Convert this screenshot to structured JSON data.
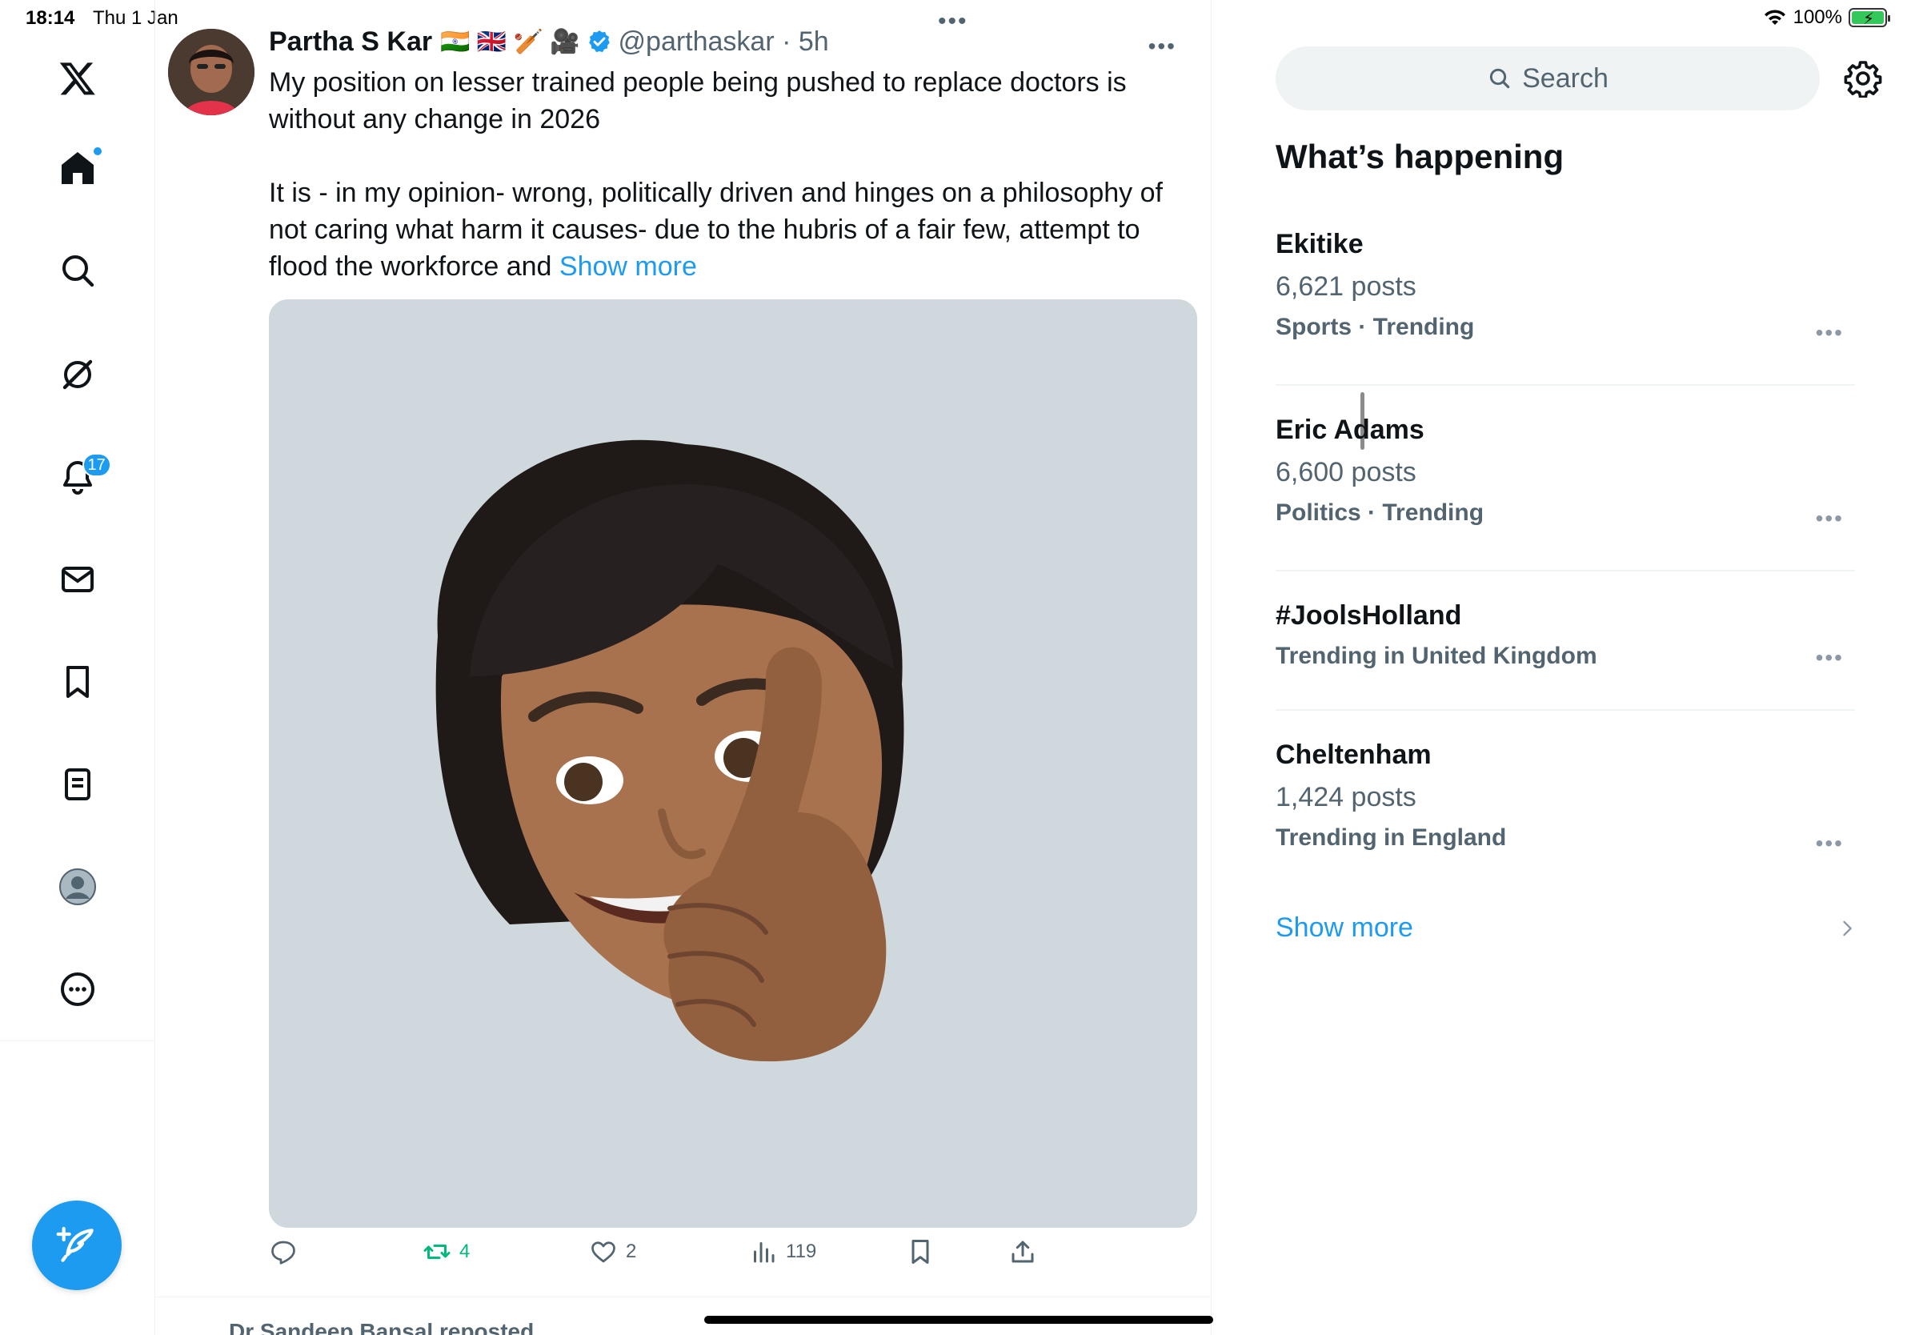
{
  "status": {
    "time": "18:14",
    "date": "Thu 1 Jan",
    "battery": "100%"
  },
  "nav": {
    "notifications_count": "17"
  },
  "tweet": {
    "author": "Partha S Kar",
    "emojis": "🇮🇳 🇬🇧 🏏 🎥",
    "handle": "@parthaskar · 5h",
    "text_para1": "My position on lesser trained people being pushed to replace doctors is without any change in 2026",
    "text_para2": "It is - in my opinion- wrong, politically driven and hinges on a philosophy of not caring what harm it causes- due to the hubris of a fair few, attempt to flood the workforce and ",
    "show_more": "Show more",
    "retweets": "4",
    "likes": "2",
    "views": "119"
  },
  "next_item": "Dr Sandeep Bansal reposted",
  "search": {
    "placeholder": "Search"
  },
  "sidebar": {
    "title": "What’s happening",
    "trends": [
      {
        "name": "Ekitike",
        "count": "6,621 posts",
        "category": "Sports · Trending"
      },
      {
        "name": "Eric Adams",
        "count": "6,600 posts",
        "category": "Politics · Trending"
      },
      {
        "name": "#JoolsHolland",
        "count": "",
        "category": "Trending in United Kingdom"
      },
      {
        "name": "Cheltenham",
        "count": "1,424 posts",
        "category": "Trending in England"
      }
    ],
    "show_more": "Show more"
  },
  "colors": {
    "accent": "#1d9bf0",
    "retweet": "#00ba7c",
    "text": "#0f1419",
    "muted": "#536471"
  }
}
